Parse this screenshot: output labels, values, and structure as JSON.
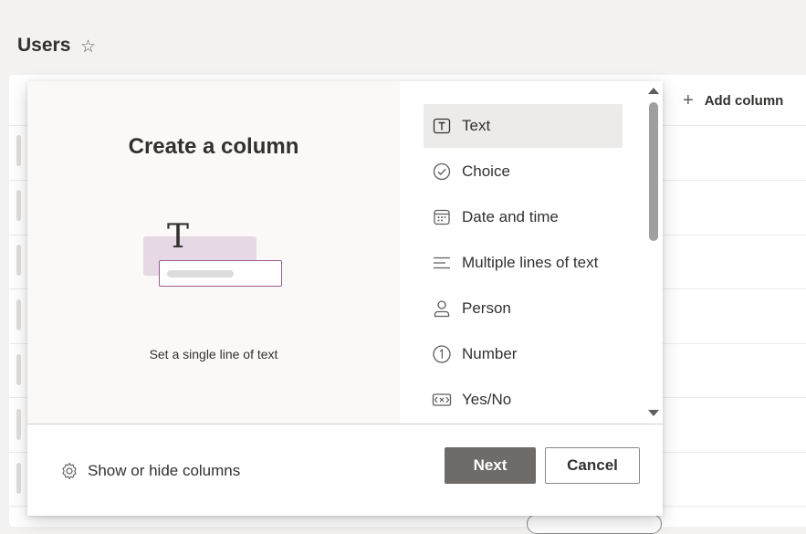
{
  "page": {
    "title": "Users"
  },
  "list": {
    "add_column_label": "Add column"
  },
  "dialog": {
    "title": "Create a column",
    "description": "Set a single line of text",
    "types": [
      {
        "label": "Text",
        "icon": "text-icon",
        "selected": true
      },
      {
        "label": "Choice",
        "icon": "choice-icon",
        "selected": false
      },
      {
        "label": "Date and time",
        "icon": "calendar-icon",
        "selected": false
      },
      {
        "label": "Multiple lines of text",
        "icon": "multiline-text-icon",
        "selected": false
      },
      {
        "label": "Person",
        "icon": "person-icon",
        "selected": false
      },
      {
        "label": "Number",
        "icon": "number-icon",
        "selected": false
      },
      {
        "label": "Yes/No",
        "icon": "yes-no-icon",
        "selected": false
      }
    ],
    "footer": {
      "show_hide_label": "Show or hide columns",
      "next_label": "Next",
      "cancel_label": "Cancel"
    }
  },
  "colors": {
    "accent": "#6f6b68",
    "selected_item": "#edebe9",
    "illustration_fill": "#e6d8e4",
    "illustration_border": "#9b5d93"
  }
}
